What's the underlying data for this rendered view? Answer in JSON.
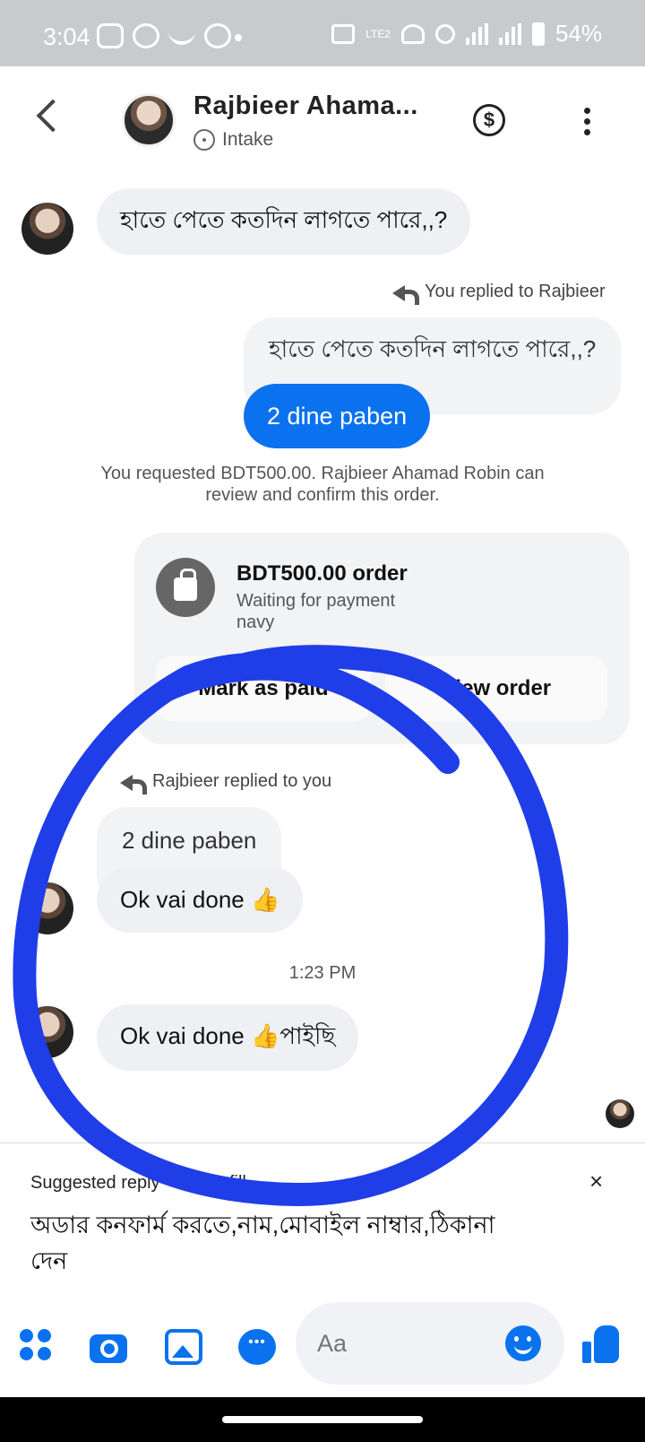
{
  "status_bar": {
    "time": "3:04",
    "battery": "54%",
    "network_label": "LTE2"
  },
  "header": {
    "contact_name": "Rajbieer Ahama...",
    "label": "Intake",
    "icons": [
      "back-icon",
      "avatar",
      "dollar-icon",
      "more-options-icon"
    ]
  },
  "messages": {
    "first_incoming": "হাতে পেতে কতদিন লাগতে পারে,,?",
    "my_reply_note": "You replied to Rajbieer",
    "my_quoted": "হাতে পেতে কতদিন লাগতে পারে,,?",
    "my_reply": "2 dine paben",
    "system_note": "You requested BDT500.00. Rajbieer Ahamad Robin can review and confirm this order.",
    "their_reply_note": "Rajbieer replied to you",
    "their_quoted": "2 dine paben",
    "their_reply": "Ok vai  done 👍",
    "timestamp": "1:23 PM",
    "last_incoming": "Ok vai done 👍পাইছি"
  },
  "order": {
    "title": "BDT500.00 order",
    "status": "Waiting for payment",
    "sub": "navy",
    "mark_paid_label": "Mark as paid",
    "view_order_label": "View order"
  },
  "suggestion": {
    "label": "Suggested reply · Tap to fill",
    "close": "×",
    "text": "অডার কনফার্ম করতে,নাম,মোবাইল নাম্বার,ঠিকানা দেন"
  },
  "composer": {
    "placeholder": "Aa"
  },
  "colors": {
    "accent": "#0a72ef",
    "annotation_ink": "#1f3ee8",
    "status_bar": "#c8cbce"
  }
}
